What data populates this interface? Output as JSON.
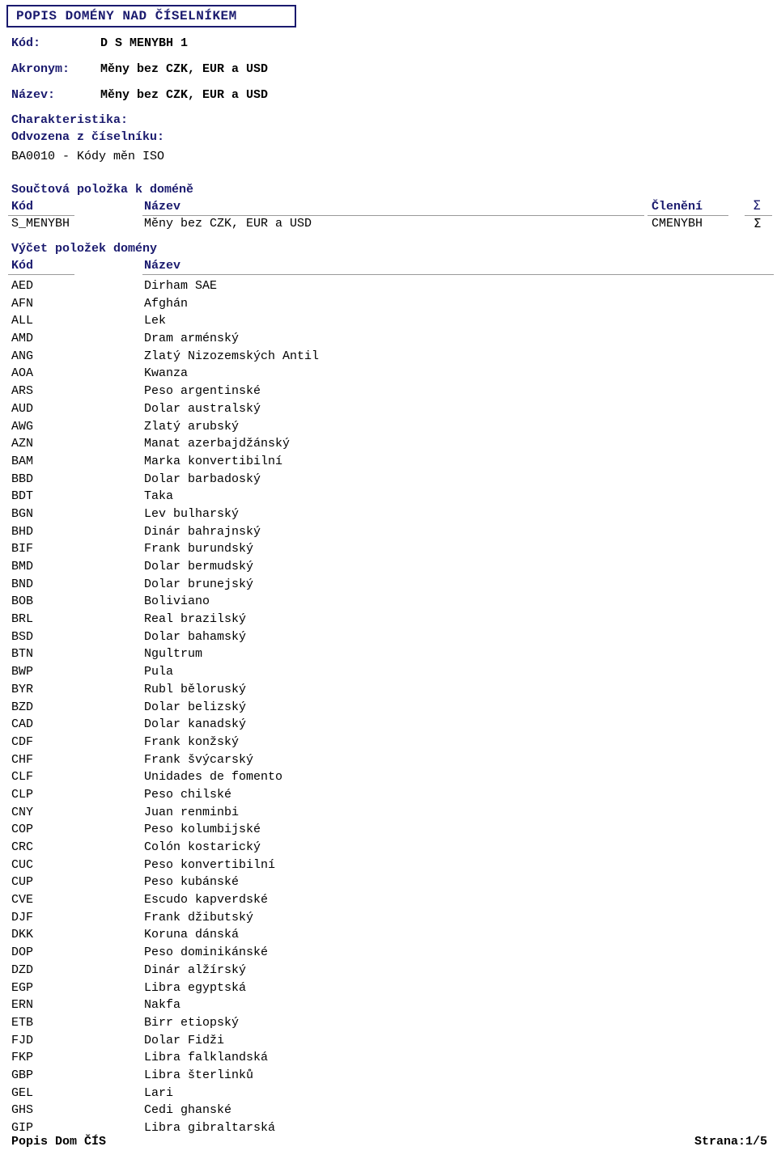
{
  "document": {
    "title": "POPIS DOMÉNY NAD ČÍSELNÍKEM"
  },
  "header_fields": [
    {
      "label": "Kód:",
      "value": "D S MENYBH 1"
    },
    {
      "label": "Akronym:",
      "value": "Měny bez CZK, EUR a USD"
    },
    {
      "label": "Název:",
      "value": "Měny bez CZK, EUR a USD"
    }
  ],
  "characteristic": {
    "label": "Charakteristika:",
    "derived_label": "Odvozena z číselníku:",
    "derived_value": "BA0010 - Kódy měn ISO"
  },
  "sum_section": {
    "title": "Součtová položka k doméně",
    "columns": {
      "code": "Kód",
      "name": "Název",
      "grouping": "Členění",
      "sigma": "Σ"
    },
    "row": {
      "code": "S_MENYBH",
      "name": "Měny bez CZK, EUR a USD",
      "grouping": "CMENYBH",
      "sigma": "Σ"
    }
  },
  "enum_section": {
    "title": "Výčet položek domény",
    "columns": {
      "code": "Kód",
      "name": "Název"
    },
    "rows": [
      {
        "code": "AED",
        "name": "Dirham SAE"
      },
      {
        "code": "AFN",
        "name": "Afghán"
      },
      {
        "code": "ALL",
        "name": "Lek"
      },
      {
        "code": "AMD",
        "name": "Dram arménský"
      },
      {
        "code": "ANG",
        "name": "Zlatý Nizozemských Antil"
      },
      {
        "code": "AOA",
        "name": "Kwanza"
      },
      {
        "code": "ARS",
        "name": "Peso argentinské"
      },
      {
        "code": "AUD",
        "name": "Dolar australský"
      },
      {
        "code": "AWG",
        "name": "Zlatý arubský"
      },
      {
        "code": "AZN",
        "name": "Manat azerbajdžánský"
      },
      {
        "code": "BAM",
        "name": "Marka konvertibilní"
      },
      {
        "code": "BBD",
        "name": "Dolar barbadoský"
      },
      {
        "code": "BDT",
        "name": "Taka"
      },
      {
        "code": "BGN",
        "name": "Lev bulharský"
      },
      {
        "code": "BHD",
        "name": "Dinár bahrajnský"
      },
      {
        "code": "BIF",
        "name": "Frank burundský"
      },
      {
        "code": "BMD",
        "name": "Dolar bermudský"
      },
      {
        "code": "BND",
        "name": "Dolar brunejský"
      },
      {
        "code": "BOB",
        "name": "Boliviano"
      },
      {
        "code": "BRL",
        "name": "Real brazilský"
      },
      {
        "code": "BSD",
        "name": "Dolar bahamský"
      },
      {
        "code": "BTN",
        "name": "Ngultrum"
      },
      {
        "code": "BWP",
        "name": "Pula"
      },
      {
        "code": "BYR",
        "name": "Rubl běloruský"
      },
      {
        "code": "BZD",
        "name": "Dolar belizský"
      },
      {
        "code": "CAD",
        "name": "Dolar kanadský"
      },
      {
        "code": "CDF",
        "name": "Frank konžský"
      },
      {
        "code": "CHF",
        "name": "Frank švýcarský"
      },
      {
        "code": "CLF",
        "name": "Unidades de fomento"
      },
      {
        "code": "CLP",
        "name": "Peso chilské"
      },
      {
        "code": "CNY",
        "name": "Juan renminbi"
      },
      {
        "code": "COP",
        "name": "Peso kolumbijské"
      },
      {
        "code": "CRC",
        "name": "Colón kostarický"
      },
      {
        "code": "CUC",
        "name": "Peso konvertibilní"
      },
      {
        "code": "CUP",
        "name": "Peso kubánské"
      },
      {
        "code": "CVE",
        "name": "Escudo kapverdské"
      },
      {
        "code": "DJF",
        "name": "Frank džibutský"
      },
      {
        "code": "DKK",
        "name": "Koruna dánská"
      },
      {
        "code": "DOP",
        "name": "Peso dominikánské"
      },
      {
        "code": "DZD",
        "name": "Dinár alžírský"
      },
      {
        "code": "EGP",
        "name": "Libra egyptská"
      },
      {
        "code": "ERN",
        "name": "Nakfa"
      },
      {
        "code": "ETB",
        "name": "Birr etiopský"
      },
      {
        "code": "FJD",
        "name": "Dolar Fidži"
      },
      {
        "code": "FKP",
        "name": "Libra falklandská"
      },
      {
        "code": "GBP",
        "name": "Libra šterlinků"
      },
      {
        "code": "GEL",
        "name": "Lari"
      },
      {
        "code": "GHS",
        "name": "Cedi ghanské"
      },
      {
        "code": "GIP",
        "name": "Libra gibraltarská"
      }
    ]
  },
  "footer": {
    "left": "Popis Dom ČÍS",
    "right": "Strana:1/5"
  },
  "colors": {
    "heading": "#1a1a6e",
    "text": "#000000",
    "rule": "#9a9a9a",
    "background": "#ffffff"
  }
}
